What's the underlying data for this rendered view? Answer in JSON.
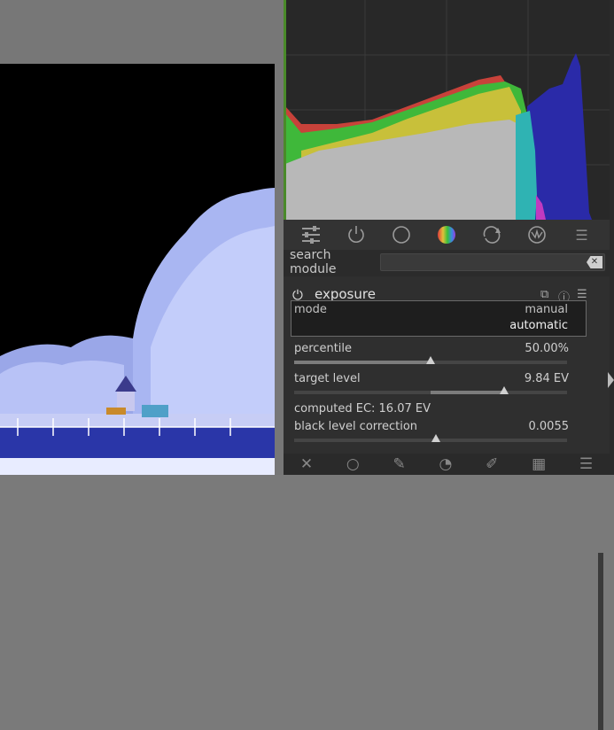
{
  "search": {
    "label": "search module",
    "value": ""
  },
  "module": {
    "name": "exposure",
    "mode": {
      "label": "mode",
      "options": [
        "manual",
        "automatic"
      ],
      "selected": "automatic"
    },
    "sliders": [
      {
        "label": "percentile",
        "value": "50.00%",
        "fraction": 0.5
      },
      {
        "label": "target level",
        "value": "9.84 EV",
        "fraction": 0.77
      },
      {
        "label": "black level correction",
        "value": "0.0055",
        "fraction": 0.52
      }
    ],
    "computed_ec": "computed EC: 16.07 EV"
  },
  "toolbar_icons": [
    "quick-access-icon",
    "power-icon",
    "circle-icon",
    "color-wheel-icon",
    "rotate-icon",
    "effect-icon",
    "menu-icon"
  ],
  "bottom_icons": [
    "close-icon",
    "circle-icon",
    "pencil-icon",
    "path-icon",
    "brush-icon",
    "checker-icon",
    "menu-icon"
  ],
  "colors": {
    "panel_bg": "#2b2b2b",
    "histogram_red": "#c8423a",
    "histogram_green": "#3fb83a",
    "histogram_blue": "#2a2aa8",
    "histogram_gray": "#b8b8b8"
  }
}
